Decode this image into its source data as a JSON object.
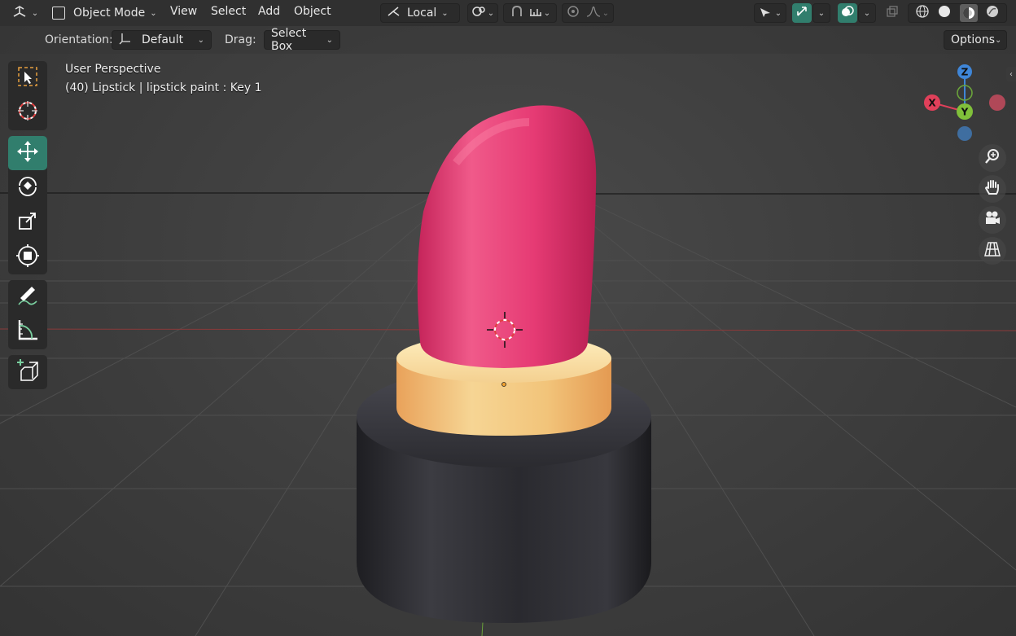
{
  "header": {
    "editor_type_icon": "3d-viewport-icon",
    "mode_label": "Object Mode",
    "menus": [
      "View",
      "Select",
      "Add",
      "Object"
    ],
    "transform_orientation": "Local",
    "pivot_icon": "pivot-point-icon",
    "snap_icon": "snap-magnet-icon",
    "proportional_icon": "proportional-edit-icon",
    "visibility_icon": "selectability-visibility-icon",
    "gizmo_icon": "gizmo-icon",
    "overlay_icon": "overlay-icon",
    "xray_icon": "xray-icon",
    "shading_modes": [
      "wireframe",
      "solid",
      "material-preview",
      "rendered"
    ],
    "active_shading": "material-preview"
  },
  "tool_settings": {
    "orientation_label": "Orientation:",
    "orientation_value": "Default",
    "drag_label": "Drag:",
    "drag_value": "Select Box",
    "options_label": "Options"
  },
  "toolbar": {
    "tools": [
      "select-box",
      "cursor",
      "move",
      "rotate",
      "scale",
      "transform",
      "annotate",
      "measure",
      "add-cube"
    ],
    "active_tool": "move"
  },
  "viewport": {
    "perspective_label": "User Perspective",
    "object_info": "(40) Lipstick | lipstick paint : Key 1"
  },
  "nav_gizmo": {
    "axes": [
      "Z",
      "X",
      "Y"
    ],
    "colors": {
      "x": "#e0405a",
      "y": "#80c03a",
      "z": "#3f86d8"
    }
  },
  "nav_buttons": [
    "zoom-icon",
    "pan-hand-icon",
    "camera-icon",
    "ortho-grid-icon"
  ],
  "colors": {
    "accent": "#317e6d",
    "lipstick": "#e33d72",
    "collar": "#f0c678",
    "base": "#2e2e33"
  }
}
